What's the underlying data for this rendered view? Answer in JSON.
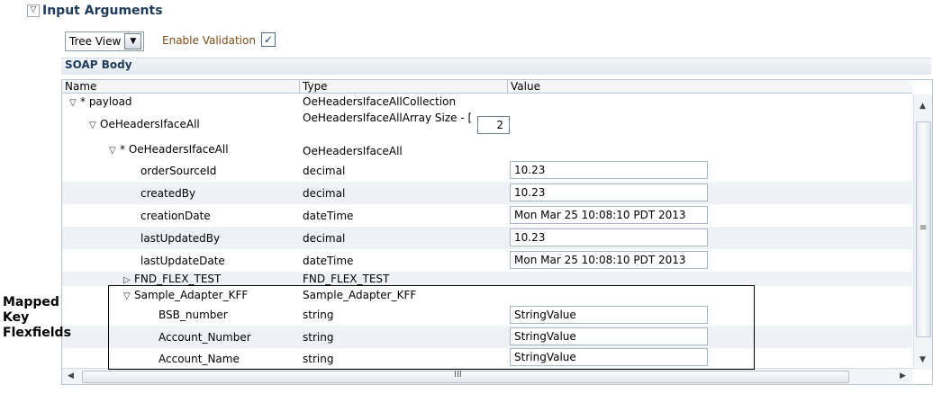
{
  "section": {
    "collapse_glyph": "▽",
    "title": "Input Arguments"
  },
  "toolbar": {
    "view_select": "Tree View",
    "enable_validation_label": "Enable Validation",
    "enable_validation_checked": true
  },
  "soap": {
    "title": "SOAP Body"
  },
  "table": {
    "headers": {
      "name": "Name",
      "type": "Type",
      "value": "Value"
    },
    "array_size_label": "OeHeadersIfaceAllArray Size - [",
    "array_size_value": "2",
    "rows": [
      {
        "name": "* payload",
        "toggle": "expanded",
        "type": "OeHeadersIfaceAllCollection",
        "value": ""
      },
      {
        "name": "OeHeadersIfaceAll",
        "toggle": "expanded",
        "type": "",
        "value": ""
      },
      {
        "name": "* OeHeadersIfaceAll",
        "toggle": "expanded",
        "type": "OeHeadersIfaceAll",
        "value": ""
      },
      {
        "name": "orderSourceId",
        "type": "decimal",
        "value": "10.23"
      },
      {
        "name": "createdBy",
        "type": "decimal",
        "value": "10.23"
      },
      {
        "name": "creationDate",
        "type": "dateTime",
        "value": "Mon Mar 25 10:08:10 PDT 2013"
      },
      {
        "name": "lastUpdatedBy",
        "type": "decimal",
        "value": "10.23"
      },
      {
        "name": "lastUpdateDate",
        "type": "dateTime",
        "value": "Mon Mar 25 10:08:10 PDT 2013"
      },
      {
        "name": "FND_FLEX_TEST",
        "toggle": "collapsed",
        "type": "FND_FLEX_TEST",
        "value": ""
      },
      {
        "name": "Sample_Adapter_KFF",
        "toggle": "expanded",
        "type": "Sample_Adapter_KFF",
        "value": ""
      },
      {
        "name": "BSB_number",
        "type": "string",
        "value": "StringValue"
      },
      {
        "name": "Account_Number",
        "type": "string",
        "value": "StringValue"
      },
      {
        "name": "Account_Name",
        "type": "string",
        "value": "StringValue"
      }
    ],
    "hscroll_grip": "III",
    "vscroll_grip": "≡"
  },
  "annotation": {
    "line1": "Mapped",
    "line2": "Key",
    "line3": "Flexfields"
  }
}
